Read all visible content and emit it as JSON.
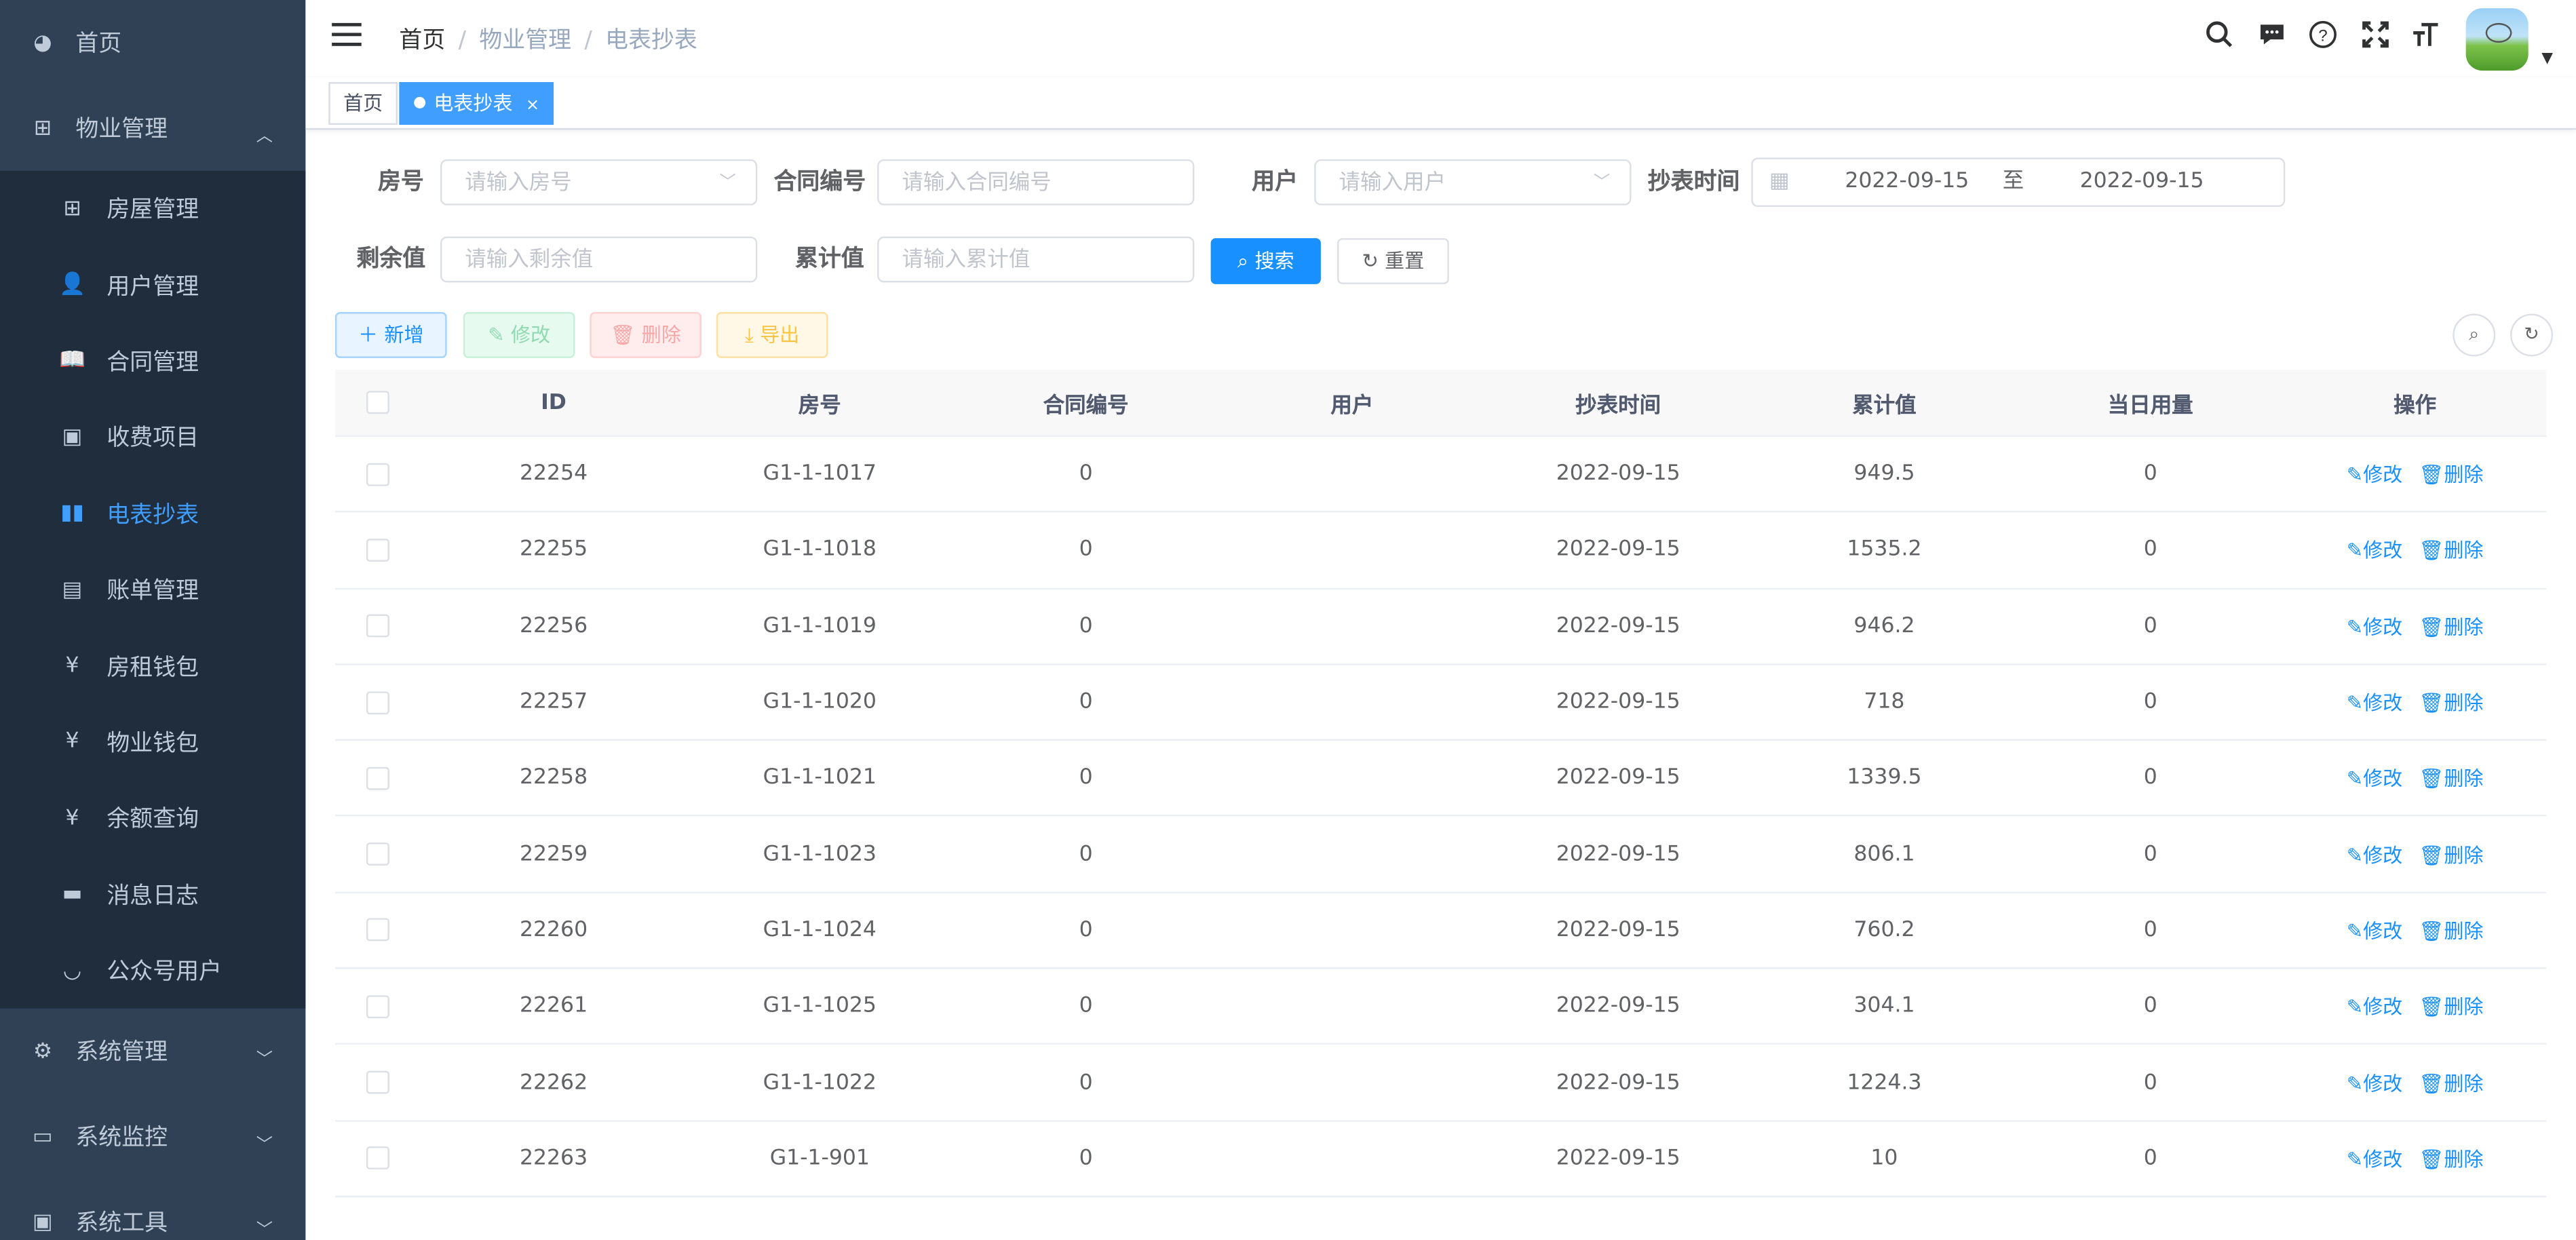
{
  "sidebar": {
    "home": {
      "label": "首页",
      "icon": "dashboard-icon"
    },
    "group": {
      "label": "物业管理",
      "icon": "tree-icon"
    },
    "items": [
      {
        "label": "房屋管理",
        "icon": "grid-icon"
      },
      {
        "label": "用户管理",
        "icon": "user-icon"
      },
      {
        "label": "合同管理",
        "icon": "book-icon"
      },
      {
        "label": "收费项目",
        "icon": "picture-icon"
      },
      {
        "label": "电表抄表",
        "icon": "book-open-icon",
        "active": true
      },
      {
        "label": "账单管理",
        "icon": "card-icon"
      },
      {
        "label": "房租钱包",
        "icon": "yen-icon"
      },
      {
        "label": "物业钱包",
        "icon": "yen-icon"
      },
      {
        "label": "余额查询",
        "icon": "yen-icon"
      },
      {
        "label": "消息日志",
        "icon": "message-icon"
      },
      {
        "label": "公众号用户",
        "icon": "eye-icon"
      }
    ],
    "bottom": [
      {
        "label": "系统管理",
        "icon": "gear-icon"
      },
      {
        "label": "系统监控",
        "icon": "monitor-icon"
      },
      {
        "label": "系统工具",
        "icon": "toolbox-icon"
      }
    ]
  },
  "breadcrumb": [
    "首页",
    "物业管理",
    "电表抄表"
  ],
  "tags": [
    {
      "label": "首页",
      "active": false
    },
    {
      "label": "电表抄表",
      "active": true,
      "close": "×"
    }
  ],
  "filters": {
    "room": {
      "label": "房号",
      "placeholder": "请输入房号"
    },
    "contract": {
      "label": "合同编号",
      "placeholder": "请输入合同编号"
    },
    "user": {
      "label": "用户",
      "placeholder": "请输入用户"
    },
    "time": {
      "label": "抄表时间",
      "start": "2022-09-15",
      "sep": "至",
      "end": "2022-09-15"
    },
    "remain": {
      "label": "剩余值",
      "placeholder": "请输入剩余值"
    },
    "total": {
      "label": "累计值",
      "placeholder": "请输入累计值"
    },
    "search_label": "搜索",
    "reset_label": "重置"
  },
  "toolbar": {
    "add": "新增",
    "edit": "修改",
    "delete": "删除",
    "export": "导出"
  },
  "table": {
    "headers": [
      "ID",
      "房号",
      "合同编号",
      "用户",
      "抄表时间",
      "累计值",
      "当日用量",
      "操作"
    ],
    "edit_label": "修改",
    "delete_label": "删除",
    "rows": [
      [
        "22254",
        "G1-1-1017",
        "0",
        "",
        "2022-09-15",
        "949.5",
        "0"
      ],
      [
        "22255",
        "G1-1-1018",
        "0",
        "",
        "2022-09-15",
        "1535.2",
        "0"
      ],
      [
        "22256",
        "G1-1-1019",
        "0",
        "",
        "2022-09-15",
        "946.2",
        "0"
      ],
      [
        "22257",
        "G1-1-1020",
        "0",
        "",
        "2022-09-15",
        "718",
        "0"
      ],
      [
        "22258",
        "G1-1-1021",
        "0",
        "",
        "2022-09-15",
        "1339.5",
        "0"
      ],
      [
        "22259",
        "G1-1-1023",
        "0",
        "",
        "2022-09-15",
        "806.1",
        "0"
      ],
      [
        "22260",
        "G1-1-1024",
        "0",
        "",
        "2022-09-15",
        "760.2",
        "0"
      ],
      [
        "22261",
        "G1-1-1025",
        "0",
        "",
        "2022-09-15",
        "304.1",
        "0"
      ],
      [
        "22262",
        "G1-1-1022",
        "0",
        "",
        "2022-09-15",
        "1224.3",
        "0"
      ],
      [
        "22263",
        "G1-1-901",
        "0",
        "",
        "2022-09-15",
        "10",
        "0"
      ]
    ]
  },
  "colors": {
    "sidebar_bg": "#304156",
    "submenu_bg": "#1f2d3d",
    "primary": "#1890ff",
    "tag_active": "#409eff"
  }
}
